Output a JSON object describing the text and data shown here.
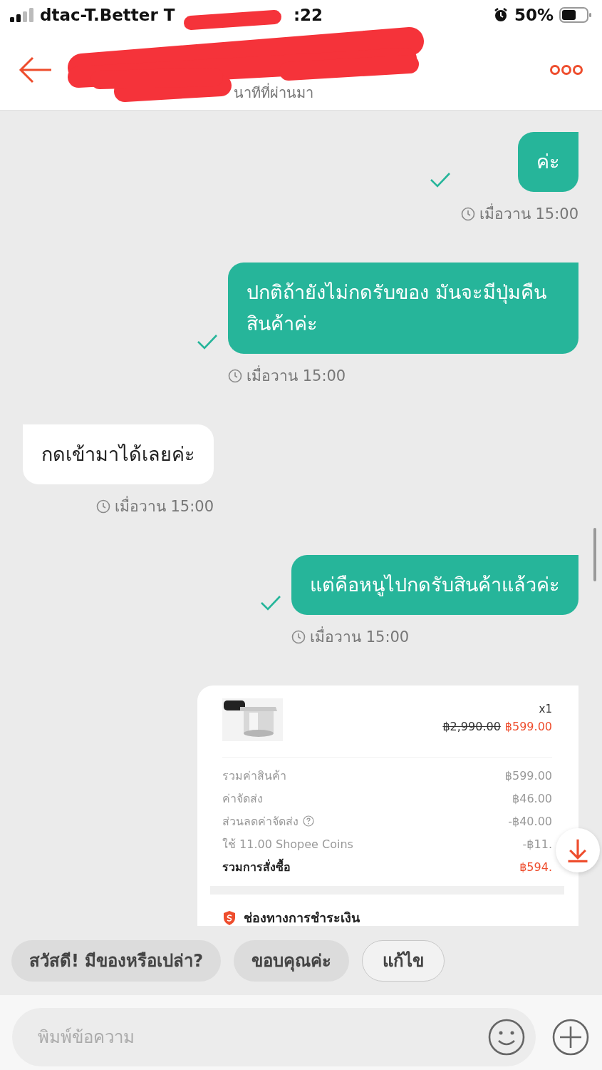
{
  "status_bar": {
    "carrier": "dtac-T.Better T",
    "time": ":22",
    "battery": "50%"
  },
  "header": {
    "subtitle": "นาทีที่ผ่านมา"
  },
  "messages": [
    {
      "kind": "sent",
      "text": "ค่ะ",
      "read": true,
      "time": "เมื่อวาน 15:00"
    },
    {
      "kind": "sent",
      "text": "ปกติถ้ายังไม่กดรับของ มันจะมีปุ่มคืนสินค้าค่ะ",
      "read": true,
      "time": "เมื่อวาน 15:00"
    },
    {
      "kind": "received",
      "text": "กดเข้ามาได้เลยค่ะ",
      "time": "เมื่อวาน 15:00"
    },
    {
      "kind": "sent",
      "text": "แต่คือหนูไปกดรับสินค้าแล้วค่ะ",
      "read": true,
      "time": "เมื่อวาน 15:00"
    },
    {
      "kind": "order",
      "quantity": "x1",
      "original_price": "฿2,990.00",
      "price": "฿599.00",
      "lines": [
        {
          "label": "รวมค่าสินค้า",
          "value": "฿599.00",
          "emphasis": false,
          "info": false
        },
        {
          "label": "ค่าจัดส่ง",
          "value": "฿46.00",
          "emphasis": false,
          "info": false
        },
        {
          "label": "ส่วนลดค่าจัดส่ง",
          "value": "-฿40.00",
          "emphasis": false,
          "info": true
        },
        {
          "label": "ใช้ 11.00 Shopee Coins",
          "value": "-฿11.",
          "emphasis": false,
          "info": false
        },
        {
          "label": "รวมการสั่งซื้อ",
          "value": "฿594.",
          "emphasis": true,
          "info": false
        }
      ],
      "payment_title": "ช่องทางการชำระเงิน"
    }
  ],
  "quick_replies": [
    {
      "text": "สวัสดี! มีของหรือเปล่า?",
      "kind": "suggestion"
    },
    {
      "text": "ขอบคุณค่ะ",
      "kind": "suggestion"
    },
    {
      "text": "แก้ไข",
      "kind": "edit"
    }
  ],
  "composer": {
    "placeholder": "พิมพ์ข้อความ"
  }
}
